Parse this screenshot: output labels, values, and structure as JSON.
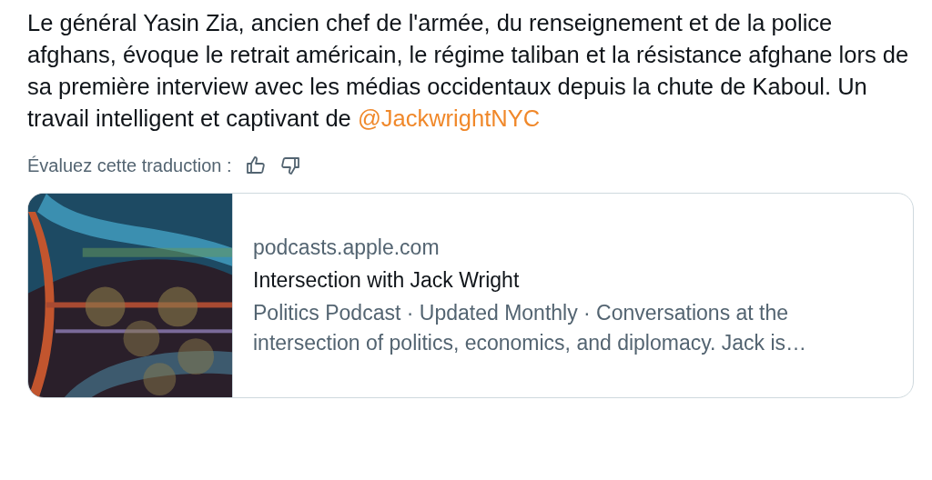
{
  "tweet": {
    "text": "Le général Yasin Zia, ancien chef de l'armée, du renseignement et de la police afghans, évoque le retrait américain, le régime taliban et la résistance afghane lors de sa première interview avec les médias occidentaux depuis la chute de Kaboul. Un travail intelligent et captivant de",
    "mention": "@JackwrightNYC"
  },
  "translation_rating": {
    "label": "Évaluez cette traduction :"
  },
  "link_card": {
    "domain": "podcasts.apple.com",
    "title": "Intersection with Jack Wright",
    "description": "Politics Podcast · Updated Monthly · Conversations at the intersection of politics, economics, and diplomacy. Jack is…"
  }
}
